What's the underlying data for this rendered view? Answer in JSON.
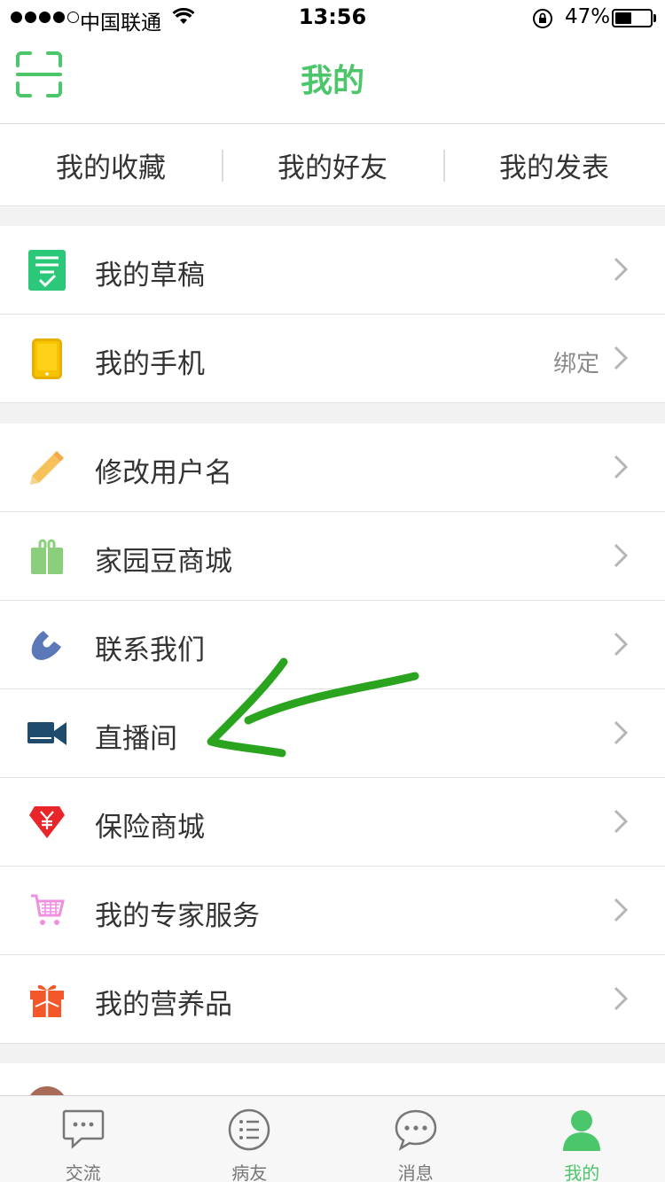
{
  "status_bar": {
    "carrier": "中国联通",
    "time": "13:56",
    "battery": "47%",
    "battery_level": 0.47
  },
  "nav": {
    "title": "我的",
    "left_icon": "scan-icon"
  },
  "segments": [
    "我的收藏",
    "我的好友",
    "我的发表"
  ],
  "group1": [
    {
      "label": "我的草稿",
      "icon": "draft-icon",
      "right": ""
    },
    {
      "label": "我的手机",
      "icon": "phone-icon",
      "right": "绑定"
    }
  ],
  "group2": [
    {
      "label": "修改用户名",
      "icon": "pencil-icon"
    },
    {
      "label": "家园豆商城",
      "icon": "shopping-bag-icon"
    },
    {
      "label": "联系我们",
      "icon": "telephone-icon"
    },
    {
      "label": "直播间",
      "icon": "video-camera-icon"
    },
    {
      "label": "保险商城",
      "icon": "insurance-gem-icon"
    },
    {
      "label": "我的专家服务",
      "icon": "cart-icon"
    },
    {
      "label": "我的营养品",
      "icon": "gift-icon"
    }
  ],
  "tabs": [
    {
      "label": "交流",
      "icon": "chat-bubble-icon",
      "active": false
    },
    {
      "label": "病友",
      "icon": "list-circle-icon",
      "active": false
    },
    {
      "label": "消息",
      "icon": "message-icon",
      "active": false
    },
    {
      "label": "我的",
      "icon": "person-icon",
      "active": true
    }
  ],
  "colors": {
    "accent": "#4cc66a",
    "background": "#f2f2f2",
    "annotation": "#2aa41e"
  }
}
